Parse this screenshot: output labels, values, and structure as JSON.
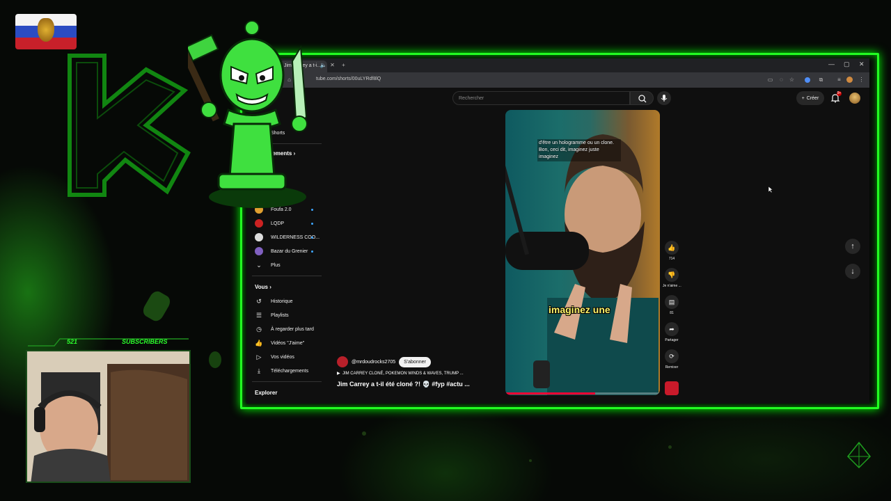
{
  "overlay": {
    "subscriber_count": "521",
    "subscriber_label": "SUBSCRIBERS"
  },
  "browser": {
    "tab_title": "Jim Carrey a t-i...",
    "url": "tube.com/shorts/00uLYRdf8lQ"
  },
  "youtube": {
    "search_placeholder": "Rechercher",
    "create_label": "Créer",
    "notification_badge": "9+",
    "sidebar": {
      "shorts_label": "Shorts",
      "subscriptions_label": "Abonnements",
      "channels": [
        {
          "name": "Foufa 2.0",
          "color": "#e0a030"
        },
        {
          "name": "LQDP",
          "color": "#cc2222"
        },
        {
          "name": "WILDERNESS COO...",
          "color": "#dddddd"
        },
        {
          "name": "Bazar du Grenier",
          "color": "#8060c0"
        }
      ],
      "more_label": "Plus",
      "you_header": "Vous",
      "you_items": [
        {
          "label": "Historique",
          "icon": "history-icon"
        },
        {
          "label": "Playlists",
          "icon": "playlist-icon"
        },
        {
          "label": "À regarder plus tard",
          "icon": "clock-icon"
        },
        {
          "label": "Vidéos \"J'aime\"",
          "icon": "thumbs-up-icon"
        },
        {
          "label": "Vos vidéos",
          "icon": "video-icon"
        },
        {
          "label": "Téléchargements",
          "icon": "download-icon"
        }
      ],
      "explore_header": "Explorer"
    },
    "short": {
      "caption_top": "d'être un hologramme ou un clone. Bon, ceci dit, imaginez juste imaginez",
      "caption_big": "imaginez une",
      "progress_fraction": 0.58,
      "channel": "@mrdoudrocks2705",
      "subscribe_label": "S'abonner",
      "sound": "JIM CARREY CLONÉ, POKEMON WINDS & WAVES, TRUMP ...",
      "title": "Jim Carrey a t-il été cloné ?! 💀 #fyp #actu ..."
    },
    "actions": {
      "like_count": "714",
      "dislike_label": "Je n'aime ...",
      "comment_count": "81",
      "share_label": "Partager",
      "remix_label": "Remixer"
    }
  },
  "colors": {
    "accent_green": "#22ff22",
    "youtube_red": "#ff0033",
    "caption_yellow": "#fff46a"
  }
}
